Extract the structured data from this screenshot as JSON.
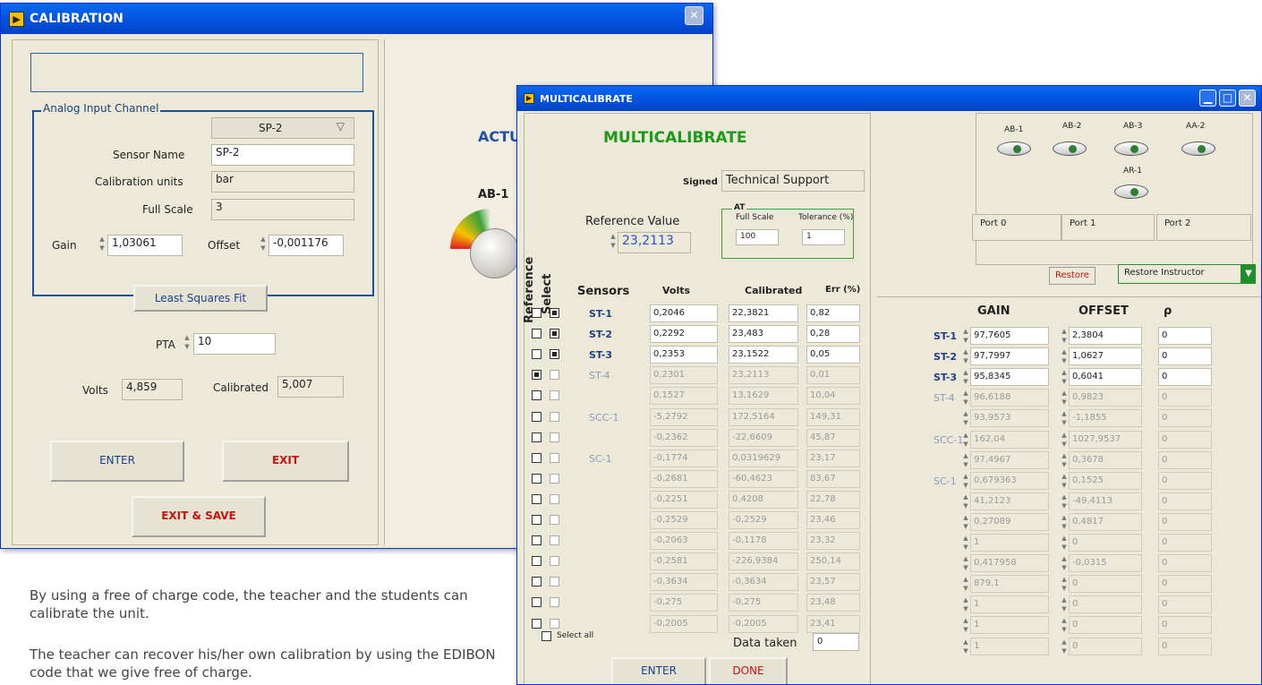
{
  "cal": {
    "title": "CALIBRATION",
    "group_title": "Analog Input Channel",
    "channel": "SP-2",
    "sensor_name_label": "Sensor Name",
    "sensor_name": "SP-2",
    "units_label": "Calibration units",
    "units": "bar",
    "full_scale_label": "Full Scale",
    "full_scale": "3",
    "gain_label": "Gain",
    "gain": "1,03061",
    "offset_label": "Offset",
    "offset": "-0,001176",
    "lsq_button": "Least Squares  Fit",
    "pta_label": "PTA",
    "pta": "10",
    "volts_label": "Volts",
    "volts": "4,859",
    "calibrated_label": "Calibrated",
    "calibrated": "5,007",
    "enter_button": "ENTER",
    "exit_button": "EXIT",
    "exit_save_button": "EXIT & SAVE",
    "right_label_actu": "ACTU",
    "right_label_ab1": "AB-1"
  },
  "mc": {
    "title": "MULTICALIBRATE",
    "heading": "MULTICALIBRATE",
    "signed_label": "Signed",
    "signed_value": "Technical Support",
    "ref_label": "Reference Value",
    "ref_value": "23,2113",
    "at_label": "AT",
    "full_scale_label": "Full Scale",
    "full_scale_value": "100",
    "tolerance_label": "Tolerance (%)",
    "tolerance_value": "1",
    "reference_header": "Reference",
    "select_header": "Select",
    "col_sensors": "Sensors",
    "col_volts": "Volts",
    "col_calibrated": "Calibrated",
    "col_err": "Err (%)",
    "rows": [
      {
        "sensor": "ST-1",
        "volts": "0,2046",
        "cal": "22,3821",
        "err": "0,82"
      },
      {
        "sensor": "ST-2",
        "volts": "0,2292",
        "cal": "23,483",
        "err": "0,28"
      },
      {
        "sensor": "ST-3",
        "volts": "0,2353",
        "cal": "23,1522",
        "err": "0,05"
      },
      {
        "sensor": "ST-4",
        "volts": "0,2301",
        "cal": "23,2113",
        "err": "0,01"
      },
      {
        "sensor": "",
        "volts": "0,1527",
        "cal": "13,1629",
        "err": "10,04"
      },
      {
        "sensor": "SCC-1",
        "volts": "-5,2792",
        "cal": "172,5164",
        "err": "149,31"
      },
      {
        "sensor": "",
        "volts": "-0,2362",
        "cal": "-22,6609",
        "err": "45,87"
      },
      {
        "sensor": "SC-1",
        "volts": "-0,1774",
        "cal": "0,0319629",
        "err": "23,17"
      },
      {
        "sensor": "",
        "volts": "-0,2681",
        "cal": "-60,4623",
        "err": "83,67"
      },
      {
        "sensor": "",
        "volts": "-0,2251",
        "cal": "0,4208",
        "err": "22,78"
      },
      {
        "sensor": "",
        "volts": "-0,2529",
        "cal": "-0,2529",
        "err": "23,46"
      },
      {
        "sensor": "",
        "volts": "-0,2063",
        "cal": "-0,1178",
        "err": "23,32"
      },
      {
        "sensor": "",
        "volts": "-0,2581",
        "cal": "-226,9384",
        "err": "250,14"
      },
      {
        "sensor": "",
        "volts": "-0,3634",
        "cal": "-0,3634",
        "err": "23,57"
      },
      {
        "sensor": "",
        "volts": "-0,275",
        "cal": "-0,275",
        "err": "23,48"
      },
      {
        "sensor": "",
        "volts": "-0,2005",
        "cal": "-0,2005",
        "err": "23,41"
      }
    ],
    "select_all_label": "Select all",
    "data_taken_label": "Data taken",
    "data_taken_value": "0",
    "enter_button": "ENTER",
    "done_button": "DONE",
    "buttons": [
      "AB-1",
      "AB-2",
      "AB-3",
      "AA-2",
      "AR-1"
    ],
    "ports": [
      "Port 0",
      "Port 1",
      "Port 2"
    ],
    "restore_button": "Restore",
    "restore_instructor_button": "Restore Instructor",
    "col_gain": "GAIN",
    "col_offset": "OFFSET",
    "col_rho": "ρ",
    "gain_rows": [
      {
        "sensor": "ST-1",
        "gain": "97,7605",
        "offset": "2,3804",
        "rho": "0"
      },
      {
        "sensor": "ST-2",
        "gain": "97,7997",
        "offset": "1,0627",
        "rho": "0"
      },
      {
        "sensor": "ST-3",
        "gain": "95,8345",
        "offset": "0,6041",
        "rho": "0"
      },
      {
        "sensor": "ST-4",
        "gain": "96,6188",
        "offset": "0,9823",
        "rho": "0"
      },
      {
        "sensor": "",
        "gain": "93,9573",
        "offset": "-1,1855",
        "rho": "0"
      },
      {
        "sensor": "SCC-1",
        "gain": "162,04",
        "offset": "1027,9537",
        "rho": "0"
      },
      {
        "sensor": "",
        "gain": "97,4967",
        "offset": "0,3678",
        "rho": "0"
      },
      {
        "sensor": "SC-1",
        "gain": "0,679363",
        "offset": "0,1525",
        "rho": "0"
      },
      {
        "sensor": "",
        "gain": "41,2123",
        "offset": "-49,4113",
        "rho": "0"
      },
      {
        "sensor": "",
        "gain": "0,27089",
        "offset": "0,4817",
        "rho": "0"
      },
      {
        "sensor": "",
        "gain": "1",
        "offset": "0",
        "rho": "0"
      },
      {
        "sensor": "",
        "gain": "0,417958",
        "offset": "-0,0315",
        "rho": "0"
      },
      {
        "sensor": "",
        "gain": "879,1",
        "offset": "0",
        "rho": "0"
      },
      {
        "sensor": "",
        "gain": "1",
        "offset": "0",
        "rho": "0"
      },
      {
        "sensor": "",
        "gain": "1",
        "offset": "0",
        "rho": "0"
      },
      {
        "sensor": "",
        "gain": "1",
        "offset": "0",
        "rho": "0"
      }
    ]
  },
  "caption": {
    "p1": "By using a free of charge code, the teacher and the students can calibrate the unit.",
    "p2": "The teacher can recover his/her own calibration by using the EDIBON code that we give free of charge."
  },
  "colors": {
    "title_blue": "#0256e4",
    "green_heading": "#1c9a1c",
    "red_button_text": "#cc1111",
    "link_blue": "#1f3f85",
    "ref_value_blue": "#2a52c8"
  }
}
